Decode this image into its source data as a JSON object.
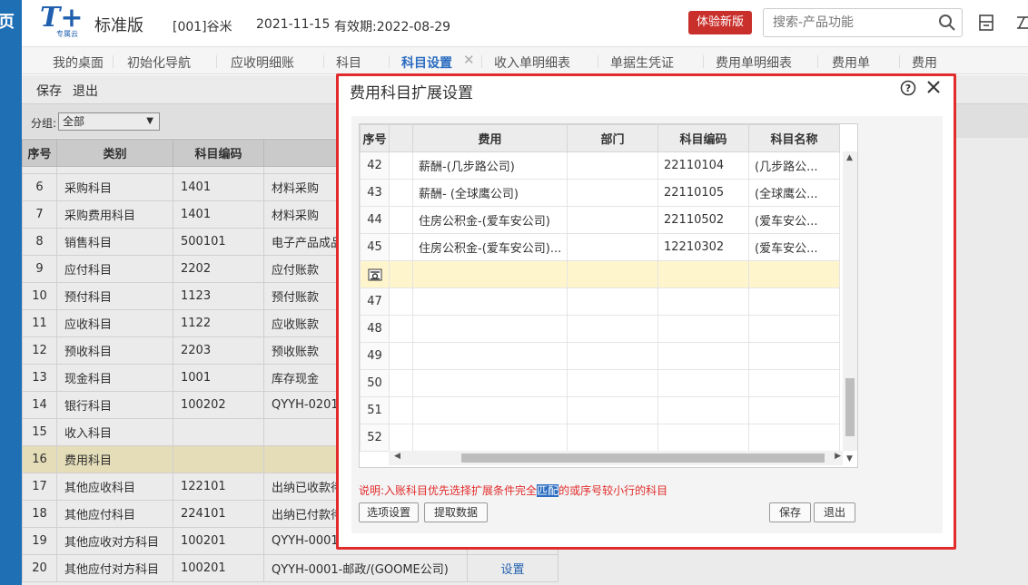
{
  "sidebar_strip": {
    "glyph": "页"
  },
  "header": {
    "logo_text": "T+",
    "logo_sub": "专属云",
    "edition": "标准版",
    "account": "[001]谷米",
    "date": "2021-11-15",
    "expiry": "有效期:2022-08-29",
    "trial_button": "体验新版",
    "search_placeholder": "搜索-产品功能",
    "icons": [
      "search-icon",
      "calculator-icon",
      "more-icon"
    ]
  },
  "tabs": [
    {
      "label": "我的桌面"
    },
    {
      "label": "初始化导航"
    },
    {
      "label": "应收明细账"
    },
    {
      "label": "科目"
    },
    {
      "label": "科目设置",
      "active": true
    },
    {
      "label": "收入单明细表"
    },
    {
      "label": "单据生凭证"
    },
    {
      "label": "费用单明细表"
    },
    {
      "label": "费用单"
    },
    {
      "label": "费用"
    }
  ],
  "toolbar": {
    "save": "保存",
    "exit": "退出"
  },
  "filter": {
    "label": "分组:",
    "value": "全部"
  },
  "bg_table": {
    "headers": [
      "序号",
      "类别",
      "科目编码",
      ""
    ],
    "rows": [
      {
        "no": "6",
        "category": "采购科目",
        "code": "1401",
        "name": "材料采购"
      },
      {
        "no": "7",
        "category": "采购费用科目",
        "code": "1401",
        "name": "材料采购"
      },
      {
        "no": "8",
        "category": "销售科目",
        "code": "500101",
        "name": "电子产品成品"
      },
      {
        "no": "9",
        "category": "应付科目",
        "code": "2202",
        "name": "应付账款"
      },
      {
        "no": "10",
        "category": "预付科目",
        "code": "1123",
        "name": "预付账款"
      },
      {
        "no": "11",
        "category": "应收科目",
        "code": "1122",
        "name": "应收账款"
      },
      {
        "no": "12",
        "category": "预收科目",
        "code": "2203",
        "name": "预收账款"
      },
      {
        "no": "13",
        "category": "现金科目",
        "code": "1001",
        "name": "库存现金"
      },
      {
        "no": "14",
        "category": "银行科目",
        "code": "100202",
        "name": "QYYH-0201-"
      },
      {
        "no": "15",
        "category": "收入科目",
        "code": "",
        "name": ""
      },
      {
        "no": "16",
        "category": "费用科目",
        "code": "",
        "name": "",
        "highlight": true
      },
      {
        "no": "17",
        "category": "其他应收科目",
        "code": "122101",
        "name": "出纳已收款待"
      },
      {
        "no": "18",
        "category": "其他应付科目",
        "code": "224101",
        "name": "出纳已付款待"
      },
      {
        "no": "19",
        "category": "其他应收对方科目",
        "code": "100201",
        "name": "QYYH-0001-"
      },
      {
        "no": "20",
        "category": "其他应付对方科目",
        "code": "100201",
        "name": "QYYH-0001-邮政/(GOOME公司)",
        "action": "设置"
      }
    ]
  },
  "modal": {
    "title": "费用科目扩展设置",
    "grid": {
      "headers": [
        "序号",
        "",
        "费用",
        "部门",
        "科目编码",
        "科目名称"
      ],
      "rows": [
        {
          "no": "42",
          "fee": "薪酬-(几步路公司)",
          "dept": "",
          "code": "22110104",
          "name": "(几步路公..."
        },
        {
          "no": "43",
          "fee": "薪酬- (全球鹰公司)",
          "dept": "",
          "code": "22110105",
          "name": "(全球鹰公..."
        },
        {
          "no": "44",
          "fee": "住房公积金-(爱车安公司)",
          "dept": "",
          "code": "22110502",
          "name": "(爱车安公..."
        },
        {
          "no": "45",
          "fee": "住房公积金-(爱车安公司)...",
          "dept": "",
          "code": "12210302",
          "name": "(爱车安公..."
        },
        {
          "no": "",
          "fee": "",
          "dept": "",
          "code": "",
          "name": "",
          "active": true
        },
        {
          "no": "47",
          "fee": "",
          "dept": "",
          "code": "",
          "name": ""
        },
        {
          "no": "48",
          "fee": "",
          "dept": "",
          "code": "",
          "name": ""
        },
        {
          "no": "49",
          "fee": "",
          "dept": "",
          "code": "",
          "name": ""
        },
        {
          "no": "50",
          "fee": "",
          "dept": "",
          "code": "",
          "name": ""
        },
        {
          "no": "51",
          "fee": "",
          "dept": "",
          "code": "",
          "name": ""
        },
        {
          "no": "52",
          "fee": "",
          "dept": "",
          "code": "",
          "name": ""
        }
      ]
    },
    "note_before": "说明:入账科目优先选择扩展条件完全",
    "note_selected": "匹配",
    "note_after": "的或序号较小行的科目",
    "buttons": {
      "options": "选项设置",
      "fetch": "提取数据",
      "save": "保存",
      "exit": "退出"
    }
  },
  "colors": {
    "accent": "#2a6cc0",
    "danger": "#e22b2b",
    "highlight": "#f8f0c8",
    "sidebar": "#1f6fb4"
  }
}
